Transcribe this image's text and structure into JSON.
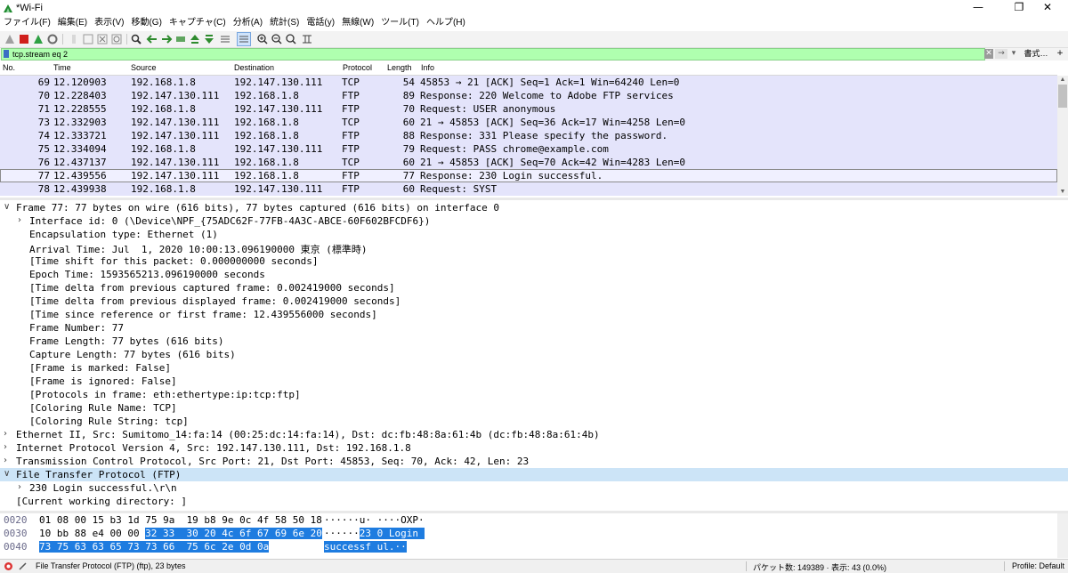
{
  "window": {
    "title": "*Wi-Fi",
    "controls": {
      "minimize": "—",
      "maximize": "❐",
      "close": "✕"
    }
  },
  "menu": [
    "ファイル(F)",
    "編集(E)",
    "表示(V)",
    "移動(G)",
    "キャプチャ(C)",
    "分析(A)",
    "統計(S)",
    "電話(y)",
    "無線(W)",
    "ツール(T)",
    "ヘルプ(H)"
  ],
  "filter": {
    "value": "tcp.stream eq 2",
    "expr_label": "書式…",
    "add_label": "+",
    "clear_icon": "✕",
    "apply_icon": "→",
    "dropdown_icon": "▾"
  },
  "packet_list": {
    "columns": [
      "No.",
      "Time",
      "Source",
      "Destination",
      "Protocol",
      "Length",
      "Info"
    ],
    "rows": [
      {
        "no": "69",
        "time": "12.120903",
        "src": "192.168.1.8",
        "dst": "192.147.130.111",
        "proto": "TCP",
        "len": "54",
        "info": "45853 → 21 [ACK] Seq=1 Ack=1 Win=64240 Len=0"
      },
      {
        "no": "70",
        "time": "12.228403",
        "src": "192.147.130.111",
        "dst": "192.168.1.8",
        "proto": "FTP",
        "len": "89",
        "info": "Response: 220 Welcome to Adobe FTP services"
      },
      {
        "no": "71",
        "time": "12.228555",
        "src": "192.168.1.8",
        "dst": "192.147.130.111",
        "proto": "FTP",
        "len": "70",
        "info": "Request: USER anonymous"
      },
      {
        "no": "73",
        "time": "12.332903",
        "src": "192.147.130.111",
        "dst": "192.168.1.8",
        "proto": "TCP",
        "len": "60",
        "info": "21 → 45853 [ACK] Seq=36 Ack=17 Win=4258 Len=0"
      },
      {
        "no": "74",
        "time": "12.333721",
        "src": "192.147.130.111",
        "dst": "192.168.1.8",
        "proto": "FTP",
        "len": "88",
        "info": "Response: 331 Please specify the password."
      },
      {
        "no": "75",
        "time": "12.334094",
        "src": "192.168.1.8",
        "dst": "192.147.130.111",
        "proto": "FTP",
        "len": "79",
        "info": "Request: PASS chrome@example.com"
      },
      {
        "no": "76",
        "time": "12.437137",
        "src": "192.147.130.111",
        "dst": "192.168.1.8",
        "proto": "TCP",
        "len": "60",
        "info": "21 → 45853 [ACK] Seq=70 Ack=42 Win=4283 Len=0"
      },
      {
        "no": "77",
        "time": "12.439556",
        "src": "192.147.130.111",
        "dst": "192.168.1.8",
        "proto": "FTP",
        "len": "77",
        "info": "Response: 230 Login successful."
      },
      {
        "no": "78",
        "time": "12.439938",
        "src": "192.168.1.8",
        "dst": "192.147.130.111",
        "proto": "FTP",
        "len": "60",
        "info": "Request: SYST"
      }
    ],
    "selected_index": 7
  },
  "details": [
    {
      "indent": 0,
      "arrow": "∨",
      "text": "Frame 77: 77 bytes on wire (616 bits), 77 bytes captured (616 bits) on interface 0"
    },
    {
      "indent": 1,
      "arrow": "›",
      "text": "Interface id: 0 (\\Device\\NPF_{75ADC62F-77FB-4A3C-ABCE-60F602BFCDF6})"
    },
    {
      "indent": 1,
      "arrow": "",
      "text": "Encapsulation type: Ethernet (1)"
    },
    {
      "indent": 1,
      "arrow": "",
      "text": "Arrival Time: Jul  1, 2020 10:00:13.096190000 東京 (標準時)"
    },
    {
      "indent": 1,
      "arrow": "",
      "text": "[Time shift for this packet: 0.000000000 seconds]"
    },
    {
      "indent": 1,
      "arrow": "",
      "text": "Epoch Time: 1593565213.096190000 seconds"
    },
    {
      "indent": 1,
      "arrow": "",
      "text": "[Time delta from previous captured frame: 0.002419000 seconds]"
    },
    {
      "indent": 1,
      "arrow": "",
      "text": "[Time delta from previous displayed frame: 0.002419000 seconds]"
    },
    {
      "indent": 1,
      "arrow": "",
      "text": "[Time since reference or first frame: 12.439556000 seconds]"
    },
    {
      "indent": 1,
      "arrow": "",
      "text": "Frame Number: 77"
    },
    {
      "indent": 1,
      "arrow": "",
      "text": "Frame Length: 77 bytes (616 bits)"
    },
    {
      "indent": 1,
      "arrow": "",
      "text": "Capture Length: 77 bytes (616 bits)"
    },
    {
      "indent": 1,
      "arrow": "",
      "text": "[Frame is marked: False]"
    },
    {
      "indent": 1,
      "arrow": "",
      "text": "[Frame is ignored: False]"
    },
    {
      "indent": 1,
      "arrow": "",
      "text": "[Protocols in frame: eth:ethertype:ip:tcp:ftp]"
    },
    {
      "indent": 1,
      "arrow": "",
      "text": "[Coloring Rule Name: TCP]"
    },
    {
      "indent": 1,
      "arrow": "",
      "text": "[Coloring Rule String: tcp]"
    },
    {
      "indent": 0,
      "arrow": "›",
      "text": "Ethernet II, Src: Sumitomo_14:fa:14 (00:25:dc:14:fa:14), Dst: dc:fb:48:8a:61:4b (dc:fb:48:8a:61:4b)"
    },
    {
      "indent": 0,
      "arrow": "›",
      "text": "Internet Protocol Version 4, Src: 192.147.130.111, Dst: 192.168.1.8"
    },
    {
      "indent": 0,
      "arrow": "›",
      "text": "Transmission Control Protocol, Src Port: 21, Dst Port: 45853, Seq: 70, Ack: 42, Len: 23"
    },
    {
      "indent": 0,
      "arrow": "∨",
      "text": "File Transfer Protocol (FTP)",
      "highlight": true
    },
    {
      "indent": 1,
      "arrow": "›",
      "text": "230 Login successful.\\r\\n"
    },
    {
      "indent": 0,
      "arrow": "",
      "text": "[Current working directory: ]"
    }
  ],
  "bytes": [
    {
      "offset": "0020",
      "hex_plain": "01 08 00 15 b3 1d 75 9a  19 b8 9e 0c 4f 58 50 18",
      "hex_hl": "",
      "ascii_plain": "······u· ····OXP·",
      "ascii_hl": ""
    },
    {
      "offset": "0030",
      "hex_plain": "10 bb 88 e4 00 00 ",
      "hex_hl": "32 33  30 20 4c 6f 67 69 6e 20",
      "ascii_plain": "······",
      "ascii_hl": "23 0 Login "
    },
    {
      "offset": "0040",
      "hex_plain": "",
      "hex_hl": "73 75 63 63 65 73 73 66  75 6c 2e 0d 0a",
      "ascii_plain": "",
      "ascii_hl": "successf ul.··"
    }
  ],
  "status": {
    "left": "File Transfer Protocol (FTP) (ftp), 23 bytes",
    "packets": "パケット数: 149389 · 表示: 43 (0.0%)",
    "profile": "Profile: Default"
  }
}
